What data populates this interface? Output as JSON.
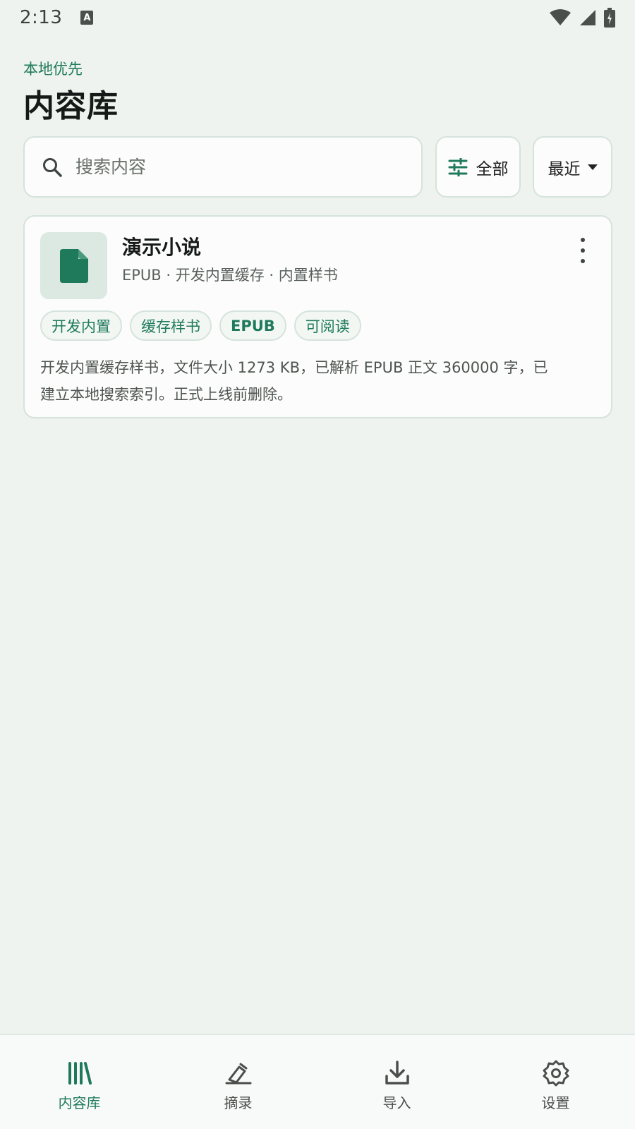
{
  "status_bar": {
    "time": "2:13",
    "app_icon_letter": "A"
  },
  "header": {
    "eyebrow": "本地优先",
    "title": "内容库"
  },
  "search": {
    "placeholder": "搜索内容",
    "value": ""
  },
  "filter": {
    "label": "全部"
  },
  "sort": {
    "label": "最近"
  },
  "items": [
    {
      "title": "演示小说",
      "meta": "EPUB · 开发内置缓存 · 内置样书",
      "tags": [
        "开发内置",
        "缓存样书",
        "EPUB",
        "可阅读"
      ],
      "description": "开发内置缓存样书，文件大小 1273 KB，已解析 EPUB 正文 360000 字，已建立本地搜索索引。正式上线前删除。"
    }
  ],
  "bottom_nav": [
    {
      "label": "内容库",
      "icon": "library-icon",
      "active": true
    },
    {
      "label": "摘录",
      "icon": "highlight-icon",
      "active": false
    },
    {
      "label": "导入",
      "icon": "download-icon",
      "active": false
    },
    {
      "label": "设置",
      "icon": "gear-icon",
      "active": false
    }
  ],
  "colors": {
    "accent": "#1f7a5c",
    "background": "#eef3ef",
    "surface": "#fbfcfb",
    "border": "#d6e3dc"
  }
}
